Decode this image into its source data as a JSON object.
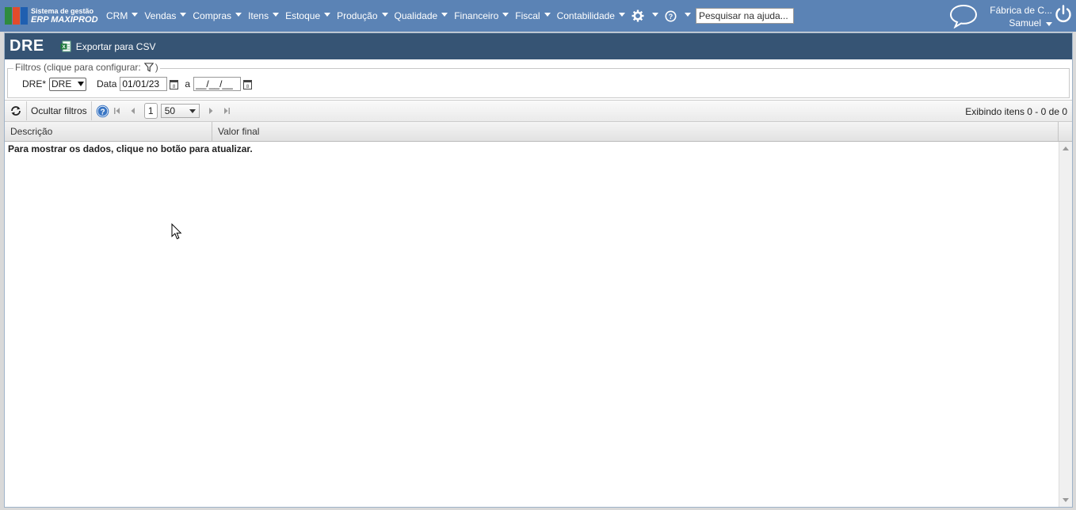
{
  "header": {
    "logo_sub": "Sistema de gestão",
    "logo_main": "ERP MAXIPROD",
    "menu": [
      {
        "label": "CRM"
      },
      {
        "label": "Vendas"
      },
      {
        "label": "Compras"
      },
      {
        "label": "Itens"
      },
      {
        "label": "Estoque"
      },
      {
        "label": "Produção"
      },
      {
        "label": "Qualidade"
      },
      {
        "label": "Financeiro"
      },
      {
        "label": "Fiscal"
      },
      {
        "label": "Contabilidade"
      }
    ],
    "search_placeholder": "Pesquisar na ajuda...",
    "company": "Fábrica de C...",
    "user": "Samuel",
    "colors": {
      "bar": "#5b83b5",
      "title": "#365474"
    }
  },
  "page": {
    "title": "DRE",
    "export_label": "Exportar para CSV"
  },
  "filters": {
    "legend": "Filtros (clique para configurar:",
    "legend_close": ")",
    "dre_label": "DRE*",
    "dre_value": "DRE",
    "date_label": "Data",
    "date_from": "01/01/23",
    "date_sep": "a",
    "date_to": "__/__/__"
  },
  "toolbar": {
    "hide_filters": "Ocultar filtros",
    "page": "1",
    "per_page": "50",
    "showing": "Exibindo itens 0 - 0 de 0"
  },
  "grid": {
    "columns": [
      "Descrição",
      "Valor final"
    ],
    "empty_message": "Para mostrar os dados, clique no botão para atualizar."
  }
}
